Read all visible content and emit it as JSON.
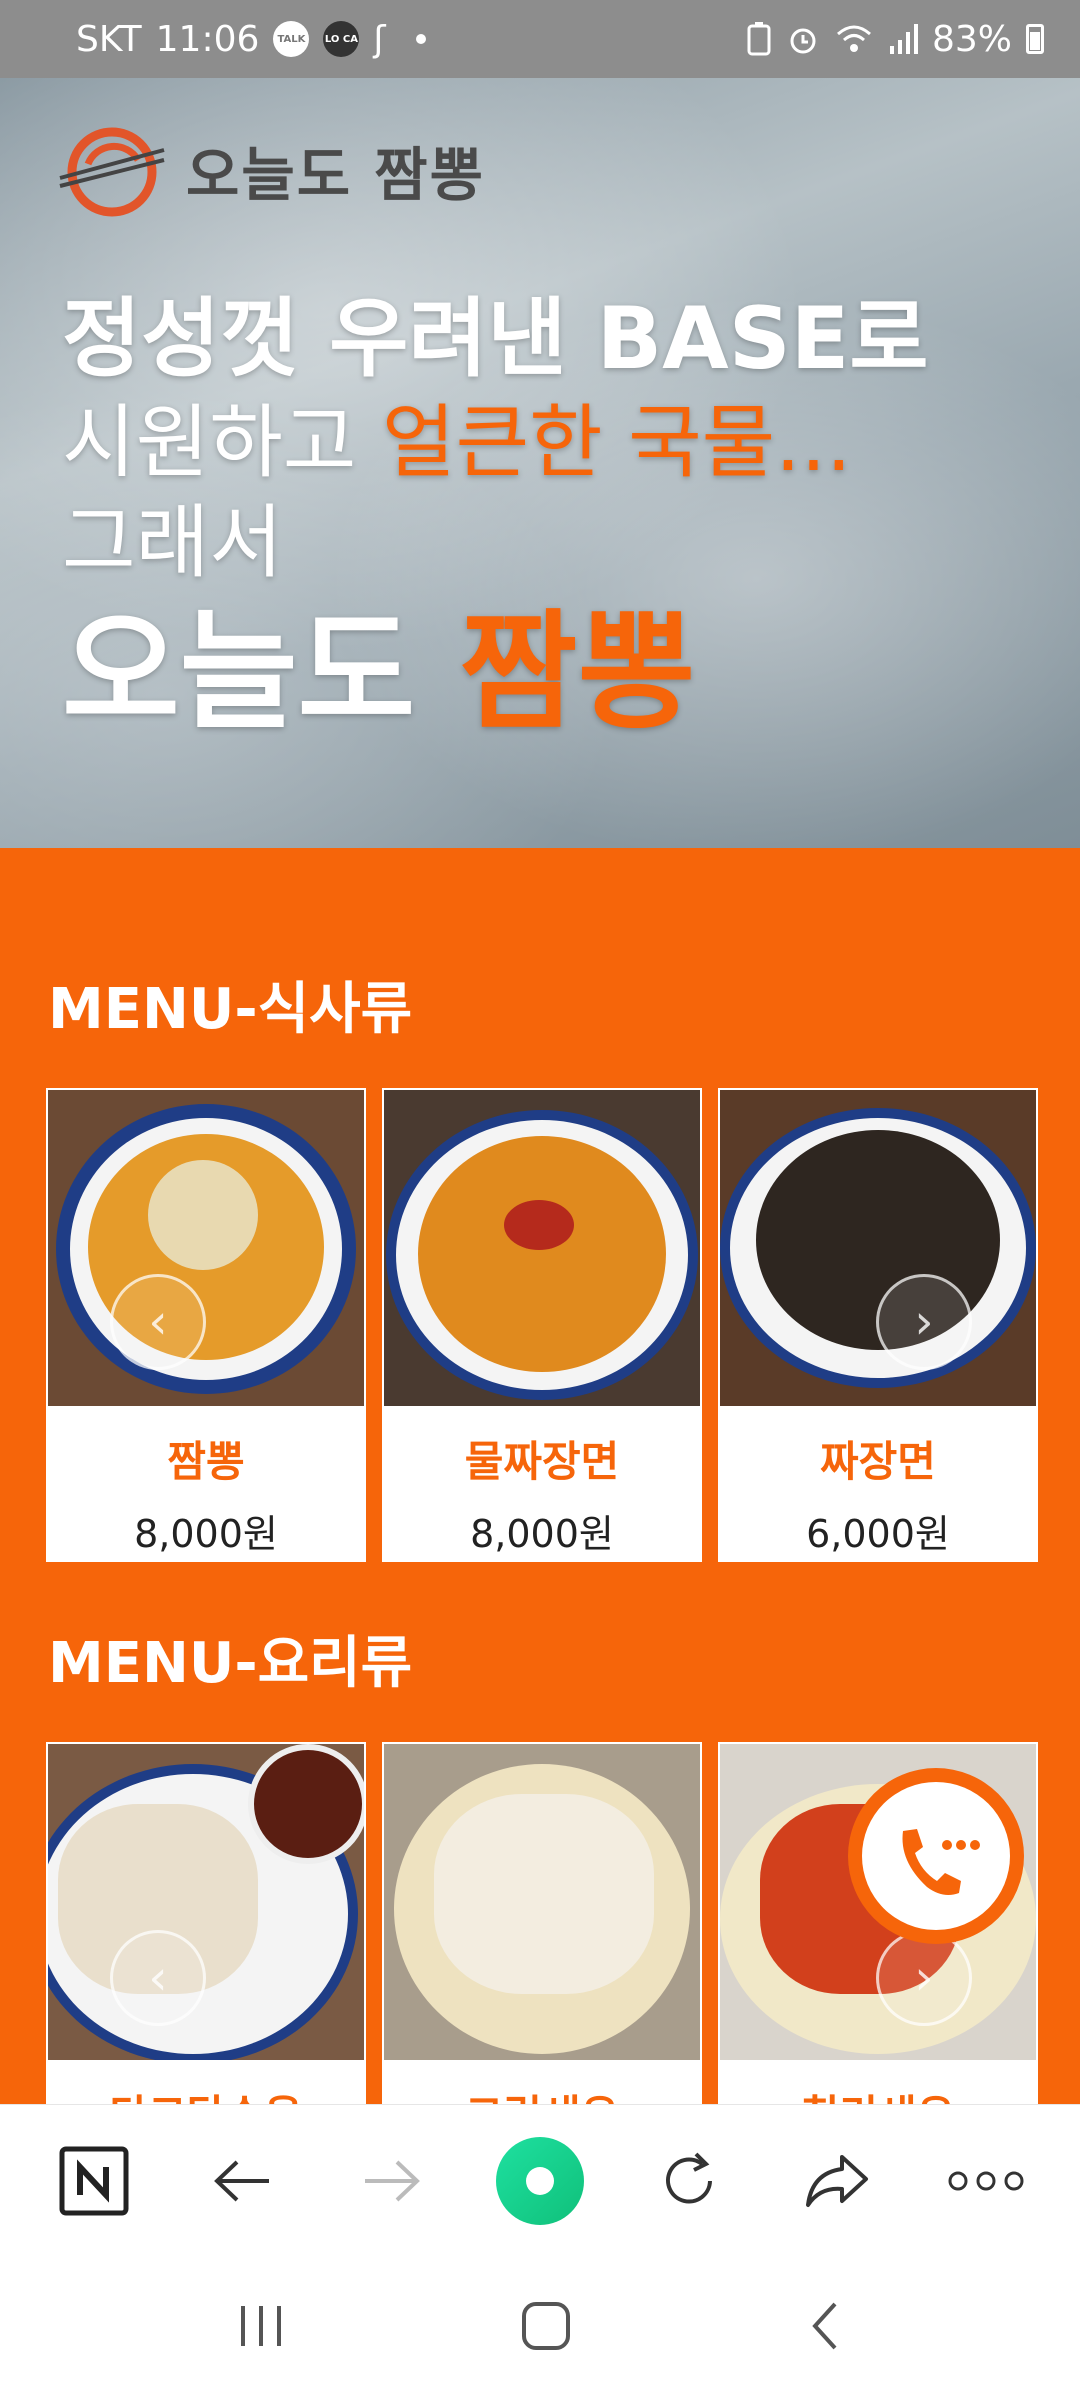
{
  "status_bar": {
    "carrier": "SKT",
    "time": "11:06",
    "badge_talk": "TALK",
    "badge_loca": "LO CA",
    "battery": "83%"
  },
  "hero": {
    "logo_text": "오늘도 짬뽕",
    "line1": "정성껏 우려낸 BASE로",
    "line2_plain": "시원하고 ",
    "line2_accent": "얼큰한 국물...",
    "line3": "그래서",
    "line4_plain": "오늘도 ",
    "line4_accent": "짬뽕"
  },
  "menu_meals": {
    "title": "MENU-식사류",
    "items": [
      {
        "name": "짬뽕",
        "price": "8,000원"
      },
      {
        "name": "물짜장면",
        "price": "8,000원"
      },
      {
        "name": "짜장면",
        "price": "6,000원"
      }
    ]
  },
  "menu_dishes": {
    "title": "MENU-요리류",
    "items": [
      {
        "name": "단코탕수육"
      },
      {
        "name": "크림새우"
      },
      {
        "name": "칠리새우"
      }
    ]
  },
  "colors": {
    "accent": "#f6650a",
    "status_bar": "#8d8d8d"
  },
  "icons": {
    "call": "phone-chat-icon",
    "browser_home": "naver-n-icon",
    "back": "arrow-left-icon",
    "forward": "arrow-right-icon",
    "center": "naver-green-dot-icon",
    "reload": "reload-icon",
    "share": "share-icon",
    "more": "more-dots-icon"
  }
}
